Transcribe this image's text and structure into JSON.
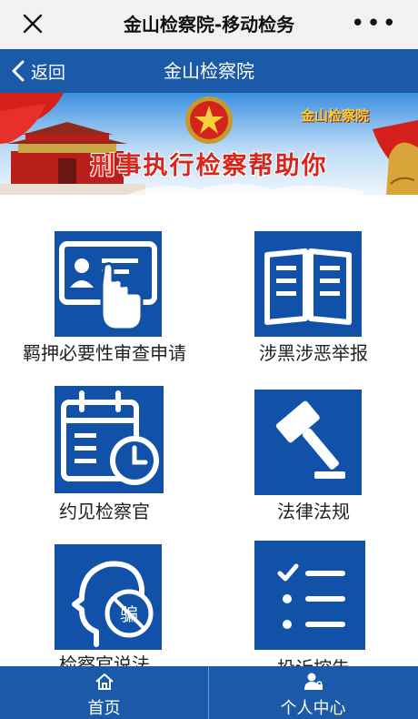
{
  "wechat_bar": {
    "title": "金山检察院-移动检务",
    "more": "•••"
  },
  "nav": {
    "back_label": "返回",
    "title": "金山检察院"
  },
  "banner": {
    "main_text": "刑事执行检察帮助你",
    "corner_text": "金山检察院"
  },
  "tiles": [
    {
      "label": "羁押必要性审查申请",
      "icon": "id-card-touch-icon"
    },
    {
      "label": "涉黑涉恶举报",
      "icon": "open-book-icon"
    },
    {
      "label": "约见检察官",
      "icon": "calendar-clock-icon"
    },
    {
      "label": "法律法规",
      "icon": "gavel-icon"
    },
    {
      "label": "检察官说法",
      "icon": "anti-fraud-head-icon"
    },
    {
      "label": "投诉控告",
      "icon": "checklist-icon"
    }
  ],
  "fraud_char": "骗",
  "tabs": [
    {
      "label": "首页",
      "icon": "home-icon"
    },
    {
      "label": "个人中心",
      "icon": "user-lock-icon"
    }
  ],
  "colors": {
    "primary_blue": "#1a5aa8",
    "tile_blue": "#1152a8",
    "banner_red": "#d9261c",
    "wechat_bar_bg": "#f2f2f2"
  }
}
